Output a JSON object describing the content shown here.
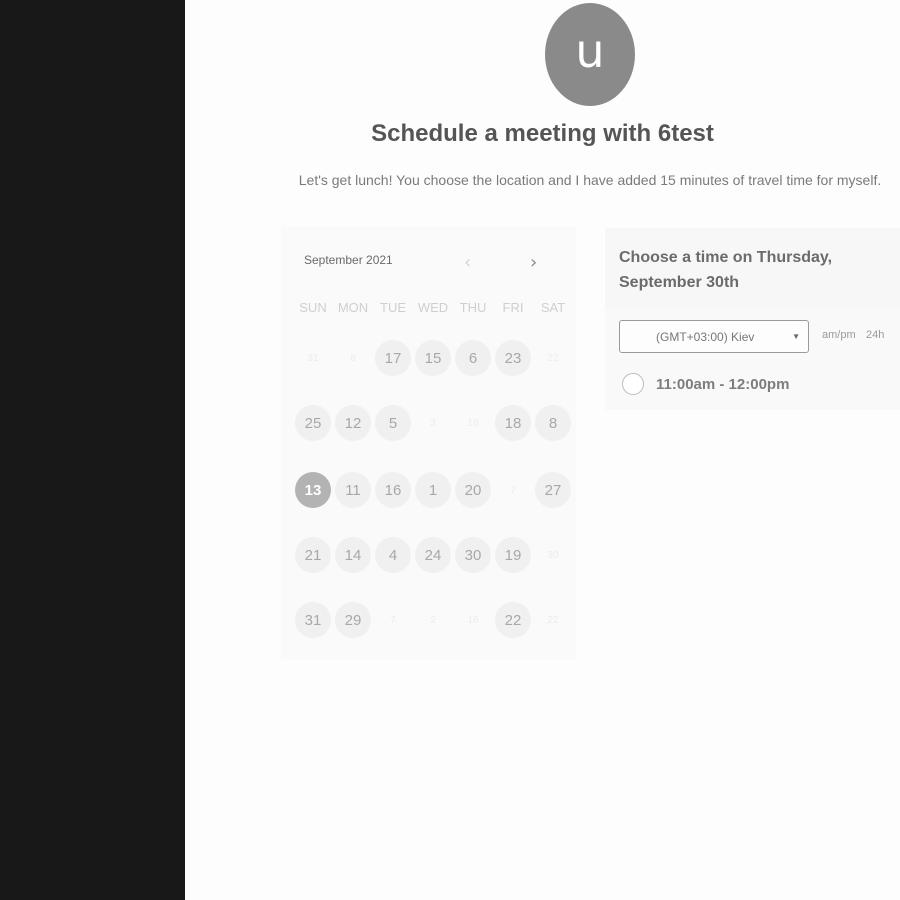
{
  "avatar": {
    "initial": "u"
  },
  "header": {
    "title": "Schedule a meeting with 6test",
    "subtitle": "Let's get lunch! You choose the location and I have added 15 minutes of travel time for myself."
  },
  "calendar": {
    "month_label": "September 2021",
    "prev_icon": "chevron-left-icon",
    "next_icon": "chevron-right-icon",
    "weekdays": [
      "SUN",
      "MON",
      "TUE",
      "WED",
      "THU",
      "FRI",
      "SAT"
    ],
    "weeks": [
      [
        {
          "label": "31",
          "state": "off"
        },
        {
          "label": "8",
          "state": "off"
        },
        {
          "label": "17",
          "state": "avail"
        },
        {
          "label": "15",
          "state": "avail"
        },
        {
          "label": "6",
          "state": "avail"
        },
        {
          "label": "23",
          "state": "avail"
        },
        {
          "label": "22",
          "state": "off"
        }
      ],
      [
        {
          "label": "25",
          "state": "avail"
        },
        {
          "label": "12",
          "state": "avail"
        },
        {
          "label": "5",
          "state": "avail"
        },
        {
          "label": "3",
          "state": "off"
        },
        {
          "label": "16",
          "state": "off"
        },
        {
          "label": "18",
          "state": "avail"
        },
        {
          "label": "8",
          "state": "avail"
        }
      ],
      [
        {
          "label": "13",
          "state": "selected"
        },
        {
          "label": "11",
          "state": "avail"
        },
        {
          "label": "16",
          "state": "avail"
        },
        {
          "label": "1",
          "state": "avail"
        },
        {
          "label": "20",
          "state": "avail"
        },
        {
          "label": "7",
          "state": "off"
        },
        {
          "label": "27",
          "state": "avail"
        }
      ],
      [
        {
          "label": "21",
          "state": "avail"
        },
        {
          "label": "14",
          "state": "avail"
        },
        {
          "label": "4",
          "state": "avail"
        },
        {
          "label": "24",
          "state": "avail"
        },
        {
          "label": "30",
          "state": "avail"
        },
        {
          "label": "19",
          "state": "avail"
        },
        {
          "label": "30",
          "state": "off"
        }
      ],
      [
        {
          "label": "31",
          "state": "avail"
        },
        {
          "label": "29",
          "state": "avail"
        },
        {
          "label": "7",
          "state": "off"
        },
        {
          "label": "2",
          "state": "off"
        },
        {
          "label": "16",
          "state": "off"
        },
        {
          "label": "22",
          "state": "avail"
        },
        {
          "label": "22",
          "state": "off"
        }
      ]
    ]
  },
  "time_panel": {
    "heading": "Choose a time on Thursday, September 30th",
    "timezone": "(GMT+03:00) Kiev",
    "format_ampm": "am/pm",
    "format_24h": "24h",
    "slots": [
      "11:00am - 12:00pm"
    ]
  }
}
